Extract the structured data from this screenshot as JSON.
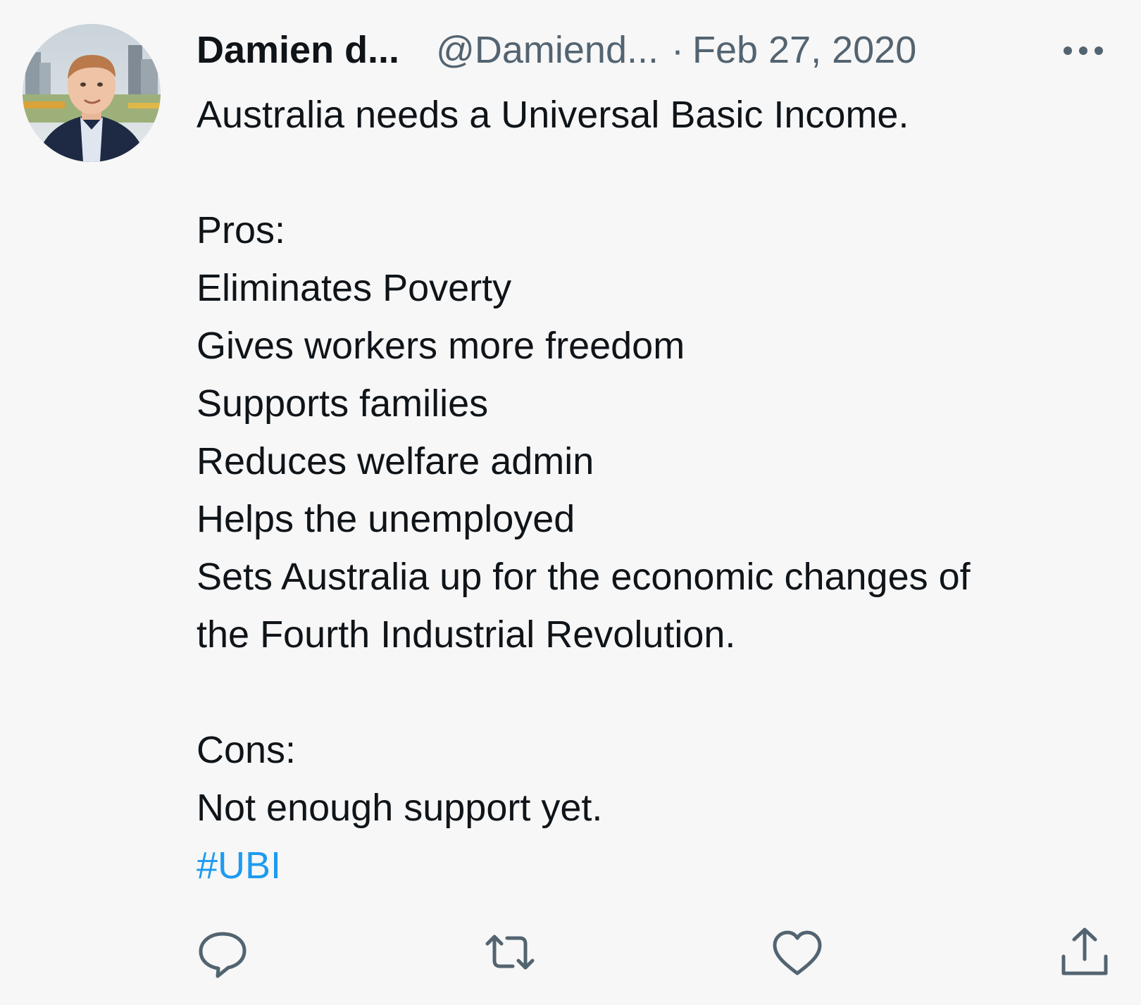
{
  "author": {
    "name": "Damien d...",
    "handle": "@Damiend...",
    "separator": "·",
    "date": "Feb 27, 2020"
  },
  "tweet": {
    "headline": "Australia needs a Universal Basic Income.",
    "pros_heading": "Pros:",
    "pros": [
      "Eliminates Poverty",
      "Gives workers more freedom",
      "Supports families",
      "Reduces welfare admin",
      "Helps the unemployed",
      "Sets Australia up for the economic changes of",
      "the Fourth Industrial Revolution."
    ],
    "cons_heading": "Cons:",
    "cons": [
      "Not enough support yet."
    ],
    "hashtag": "#UBI"
  },
  "icons": {
    "more": "more-options-icon",
    "reply": "reply-icon",
    "retweet": "retweet-icon",
    "like": "like-icon",
    "share": "share-icon"
  },
  "colors": {
    "background": "#f7f7f7",
    "text": "#0f1419",
    "muted": "#536471",
    "link": "#1d9bf0"
  }
}
